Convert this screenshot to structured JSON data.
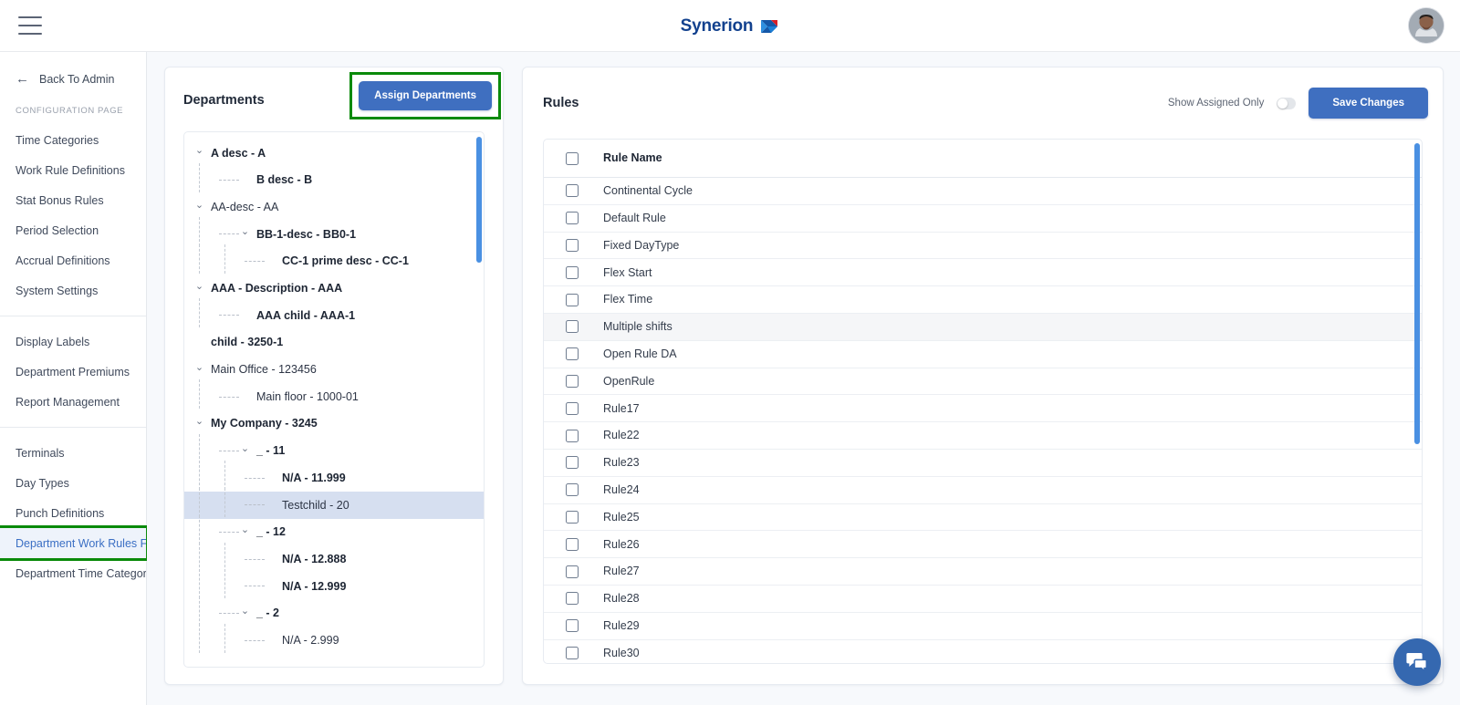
{
  "header": {
    "menu_icon": "hamburger-menu-icon",
    "logo_text": "Synerion",
    "logo_mark_icon": "synerion-arrow-logo-icon",
    "avatar_icon": "user-avatar"
  },
  "sidebar": {
    "back_label": "Back To Admin",
    "back_icon": "arrow-left-icon",
    "section_caption": "CONFIGURATION PAGE",
    "group1": [
      {
        "label": "Time Categories"
      },
      {
        "label": "Work Rule Definitions"
      },
      {
        "label": "Stat Bonus Rules"
      },
      {
        "label": "Period Selection"
      },
      {
        "label": "Accrual Definitions"
      },
      {
        "label": "System Settings"
      }
    ],
    "group2": [
      {
        "label": "Display Labels"
      },
      {
        "label": "Department Premiums"
      },
      {
        "label": "Report Management"
      }
    ],
    "group3": [
      {
        "label": "Terminals"
      },
      {
        "label": "Day Types"
      },
      {
        "label": "Punch Definitions"
      },
      {
        "label": "Department Work Rules Filt...",
        "active": true,
        "highlighted": true
      },
      {
        "label": "Department Time Category ..."
      }
    ]
  },
  "departments": {
    "title": "Departments",
    "assign_button": "Assign Departments",
    "assign_button_highlighted": true,
    "tree": [
      {
        "label": "A desc - A",
        "depth": 0,
        "caret": "down",
        "bold": true,
        "selected": false
      },
      {
        "label": "B desc - B",
        "depth": 1,
        "caret": "none",
        "bold": true,
        "selected": false
      },
      {
        "label": "AA-desc - AA",
        "depth": 0,
        "caret": "down",
        "bold": false,
        "selected": false
      },
      {
        "label": "BB-1-desc - BB0-1",
        "depth": 1,
        "caret": "down",
        "bold": true,
        "selected": false
      },
      {
        "label": "CC-1 prime desc - CC-1",
        "depth": 2,
        "caret": "none",
        "bold": true,
        "selected": false
      },
      {
        "label": "AAA - Description - AAA",
        "depth": 0,
        "caret": "down",
        "bold": true,
        "selected": false
      },
      {
        "label": "AAA child - AAA-1",
        "depth": 1,
        "caret": "none",
        "bold": true,
        "selected": false
      },
      {
        "label": "child - 3250-1",
        "depth": 0,
        "caret": "none",
        "bold": true,
        "selected": false
      },
      {
        "label": "Main Office - 123456",
        "depth": 0,
        "caret": "down",
        "bold": false,
        "selected": false
      },
      {
        "label": "Main floor - 1000-01",
        "depth": 1,
        "caret": "none",
        "bold": false,
        "selected": false
      },
      {
        "label": "My Company - 3245",
        "depth": 0,
        "caret": "down",
        "bold": true,
        "selected": false
      },
      {
        "label": "_ - 11",
        "depth": 1,
        "caret": "down",
        "bold": true,
        "selected": false
      },
      {
        "label": "N/A - 11.999",
        "depth": 2,
        "caret": "none",
        "bold": true,
        "selected": false
      },
      {
        "label": "Testchild - 20",
        "depth": 2,
        "caret": "none",
        "bold": false,
        "selected": true
      },
      {
        "label": "_ - 12",
        "depth": 1,
        "caret": "down",
        "bold": true,
        "selected": false
      },
      {
        "label": "N/A - 12.888",
        "depth": 2,
        "caret": "none",
        "bold": true,
        "selected": false
      },
      {
        "label": "N/A - 12.999",
        "depth": 2,
        "caret": "none",
        "bold": true,
        "selected": false
      },
      {
        "label": "_ - 2",
        "depth": 1,
        "caret": "down",
        "bold": true,
        "selected": false
      },
      {
        "label": "N/A - 2.999",
        "depth": 2,
        "caret": "none",
        "bold": false,
        "selected": false
      }
    ]
  },
  "rules": {
    "title": "Rules",
    "toggle_label": "Show Assigned Only",
    "toggle_state": "off",
    "save_button": "Save Changes",
    "column_header": "Rule Name",
    "items": [
      {
        "name": "Continental Cycle",
        "checked": false,
        "hover": false
      },
      {
        "name": "Default Rule",
        "checked": false,
        "hover": false
      },
      {
        "name": "Fixed DayType",
        "checked": false,
        "hover": false
      },
      {
        "name": "Flex Start",
        "checked": false,
        "hover": false
      },
      {
        "name": "Flex Time",
        "checked": false,
        "hover": false
      },
      {
        "name": "Multiple shifts",
        "checked": false,
        "hover": true
      },
      {
        "name": "Open Rule DA",
        "checked": false,
        "hover": false
      },
      {
        "name": "OpenRule",
        "checked": false,
        "hover": false
      },
      {
        "name": "Rule17",
        "checked": false,
        "hover": false
      },
      {
        "name": "Rule22",
        "checked": false,
        "hover": false
      },
      {
        "name": "Rule23",
        "checked": false,
        "hover": false
      },
      {
        "name": "Rule24",
        "checked": false,
        "hover": false
      },
      {
        "name": "Rule25",
        "checked": false,
        "hover": false
      },
      {
        "name": "Rule26",
        "checked": false,
        "hover": false
      },
      {
        "name": "Rule27",
        "checked": false,
        "hover": false
      },
      {
        "name": "Rule28",
        "checked": false,
        "hover": false
      },
      {
        "name": "Rule29",
        "checked": false,
        "hover": false
      },
      {
        "name": "Rule30",
        "checked": false,
        "hover": false
      }
    ]
  },
  "chat": {
    "icon": "chat-bubble-icon"
  },
  "colors": {
    "accent_blue": "#3f6fc0",
    "scrollbar_blue": "#4a90e2",
    "highlight_green": "#0a8a0a",
    "selected_row": "#d6dff0",
    "logo_blue": "#12418e"
  }
}
